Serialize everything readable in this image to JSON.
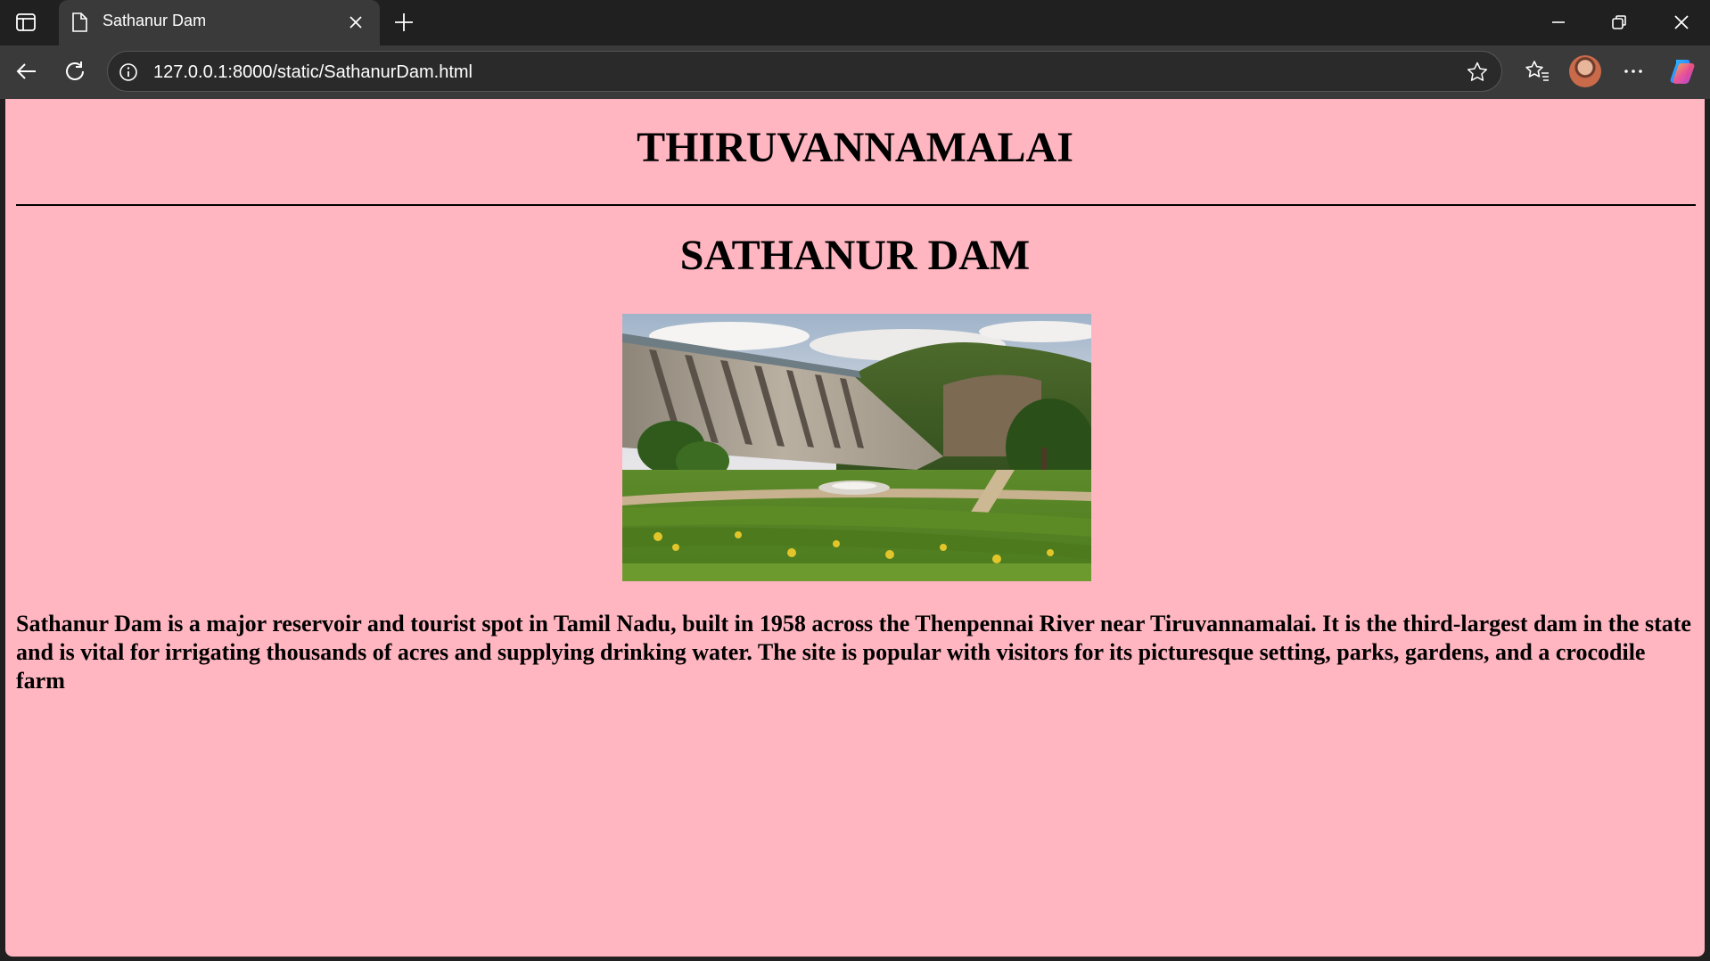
{
  "browser": {
    "tab_title": "Sathanur Dam",
    "url": "127.0.0.1:8000/static/SathanurDam.html",
    "icons": [
      "sidebar-toggle-icon",
      "document-icon",
      "close-icon",
      "plus-icon",
      "minimize-icon",
      "restore-icon",
      "close-window-icon",
      "back-arrow-icon",
      "reload-icon",
      "info-icon",
      "star-icon",
      "favorites-icon",
      "avatar",
      "more-icon",
      "copilot-icon"
    ]
  },
  "page": {
    "background_color": "#ffb6c1",
    "heading": "THIRUVANNAMALAI",
    "subheading": "SATHANUR DAM",
    "image_description": "photo of Sathanur Dam with spillway gates, gardens and green hills",
    "description": "Sathanur Dam is a major reservoir and tourist spot in Tamil Nadu, built in 1958 across the Thenpennai River near Tiruvannamalai. It is the third-largest dam in the state and is vital for irrigating thousands of acres and supplying drinking water. The site is popular with visitors for its picturesque setting, parks, gardens, and a crocodile farm"
  }
}
